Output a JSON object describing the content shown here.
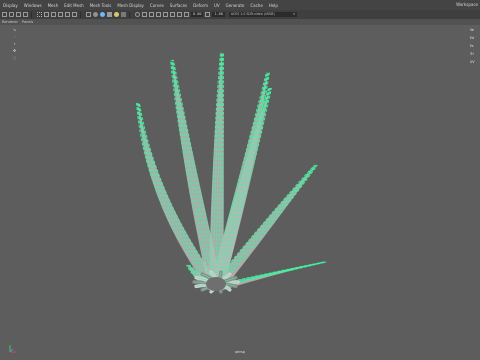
{
  "menu": {
    "items": [
      "Display",
      "Windows",
      "Mesh",
      "Edit Mesh",
      "Mesh Tools",
      "Mesh Display",
      "Curves",
      "Surfaces",
      "Deform",
      "UV",
      "Generate",
      "Cache",
      "Help"
    ],
    "workspace_label": "Workspace"
  },
  "toolbar": {
    "field_a": "0.00",
    "field_b": "1.00",
    "color_space": "ACES 1.0 SDR-video (sRGB)"
  },
  "panel_menu": {
    "items": [
      "Renderer",
      "Panels"
    ]
  },
  "hud": {
    "rows": [
      "Ve",
      "Ed",
      "Fa",
      "Tri",
      "UV"
    ]
  },
  "viewport": {
    "camera_label": "persp",
    "mesh_fill": "#b9b9b9",
    "wire_color": "#44f0a0"
  }
}
